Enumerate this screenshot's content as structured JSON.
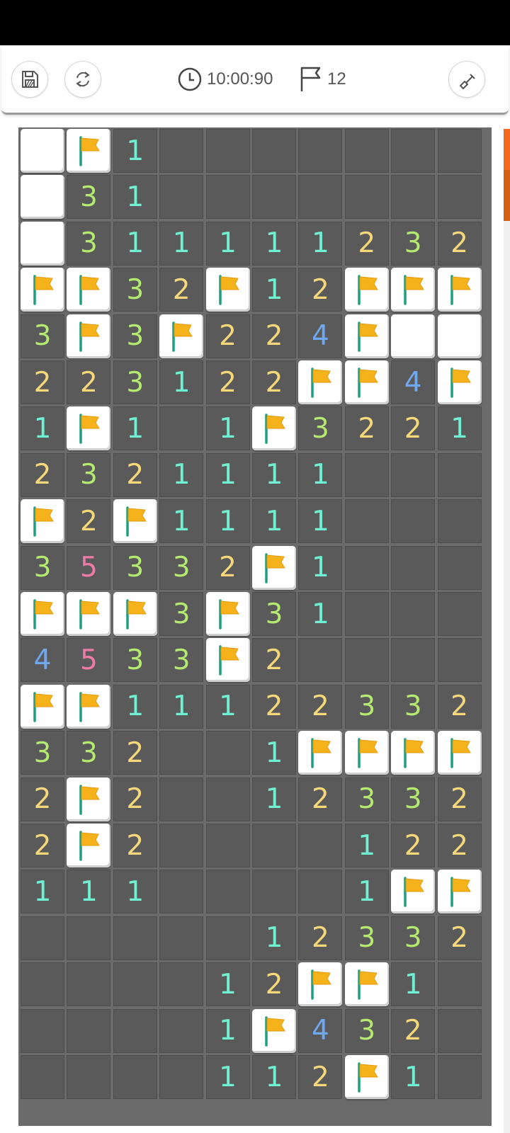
{
  "toolbar": {
    "save_icon": "floppy-disk-icon",
    "restart_icon": "refresh-icon",
    "timer_icon": "clock-icon",
    "timer": "10:00:90",
    "flags_icon": "flag-icon",
    "flags_count": "12",
    "tool_icon": "shovel-icon"
  },
  "colors": {
    "1": "#6ff0d2",
    "2": "#f6d87a",
    "3": "#b4ea6f",
    "4": "#6fa8ee",
    "5": "#ee7aa6",
    "flag": "#f6b21a",
    "scroll_accent": "#f26a1b"
  },
  "board": {
    "legend": "E = revealed empty, F = flag, . = unrevealed, digits = adjacent mine count",
    "rows": [
      "EF1.......",
      "E31.......",
      "E311111232",
      "FF32F12FFF",
      "3F3F224FEE",
      "223122FF4F",
      "1F1.1F3221",
      "2321111...",
      "F2F1111...",
      "35332F1...",
      "FFF3F31...",
      "4533F2....",
      "FF11122332",
      "332..1FFFF",
      "2F2..12332",
      "2F2....122",
      "111....1FF",
      ".....12332",
      "....12FF1.",
      "....1F432.",
      "....112F1."
    ]
  }
}
